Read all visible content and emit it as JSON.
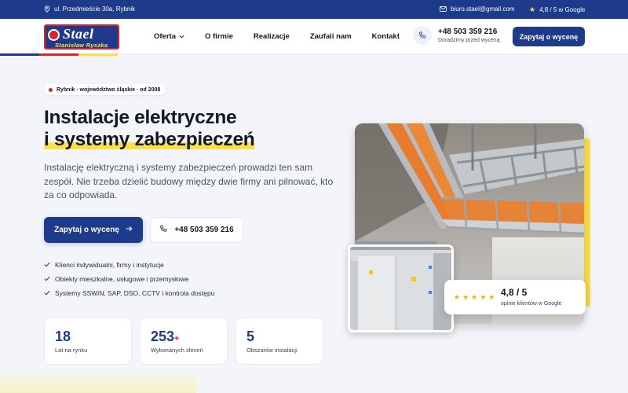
{
  "topbar": {
    "address": "ul. Przedmieście 30a, Rybnik",
    "email": "biuro.stael@gmail.com",
    "rating": "4,8 / 5 w Google"
  },
  "header": {
    "logo": {
      "word": "Stael",
      "sub": "Stanisław Ryszka"
    },
    "nav": [
      {
        "label": "Oferta",
        "dropdown": true
      },
      {
        "label": "O firmie"
      },
      {
        "label": "Realizacje"
      },
      {
        "label": "Zaufali nam"
      },
      {
        "label": "Kontakt"
      }
    ],
    "phone": {
      "number": "+48 503 359 216",
      "note": "Doradzimy przed wyceną"
    },
    "cta": "Zapytaj o wycenę"
  },
  "hero": {
    "badge": "Rybnik · województwo śląskie · od 2008",
    "title_line1": "Instalacje elektryczne",
    "title_line2": "i systemy zabezpieczeń",
    "lead": "Instalację elektryczną i systemy zabezpieczeń prowadzi ten sam zespół. Nie trzeba dzielić budowy między dwie firmy ani pilnować, kto za co odpowiada.",
    "cta_primary": "Zapytaj o wycenę",
    "cta_phone": "+48 503 359 216",
    "checks": [
      "Klienci indywidualni, firmy i instytucje",
      "Obiekty mieszkalne, usługowe i przemysłowe",
      "Systemy SSWiN, SAP, DSO, CCTV i kontrola dostępu"
    ],
    "stats": [
      {
        "value": "18",
        "plus": "",
        "label": "Lat na rynku"
      },
      {
        "value": "253",
        "plus": "+",
        "label": "Wykonanych zleceń"
      },
      {
        "value": "5",
        "plus": "",
        "label": "Obszarów instalacji"
      }
    ],
    "rating_card": {
      "score": "4,8 / 5",
      "caption": "opinie klientów w Google",
      "stars": 5
    }
  },
  "colors": {
    "brand_blue": "#1e3a8a",
    "accent_red": "#dc2626",
    "accent_yellow": "#fde047"
  }
}
